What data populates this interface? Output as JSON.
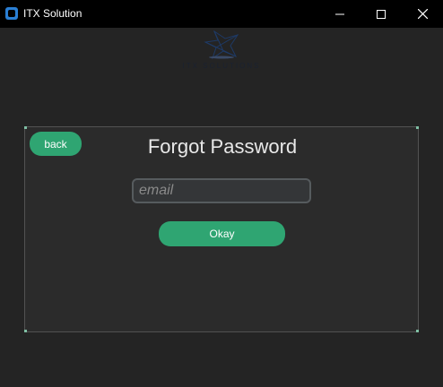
{
  "window": {
    "title": "ITX Solution",
    "icon": "app-icon",
    "controls": [
      "minimize-icon",
      "maximize-icon",
      "close-icon"
    ]
  },
  "logo": {
    "text": "ITX SOLUTIONS",
    "color": "#1e3a66"
  },
  "form": {
    "back_label": "back",
    "heading": "Forgot Password",
    "email_placeholder": "email",
    "email_value": "",
    "okay_label": "Okay"
  },
  "colors": {
    "accent": "#2fa572",
    "background": "#242424",
    "panel": "#2b2b2b",
    "titlebar": "#000000"
  }
}
